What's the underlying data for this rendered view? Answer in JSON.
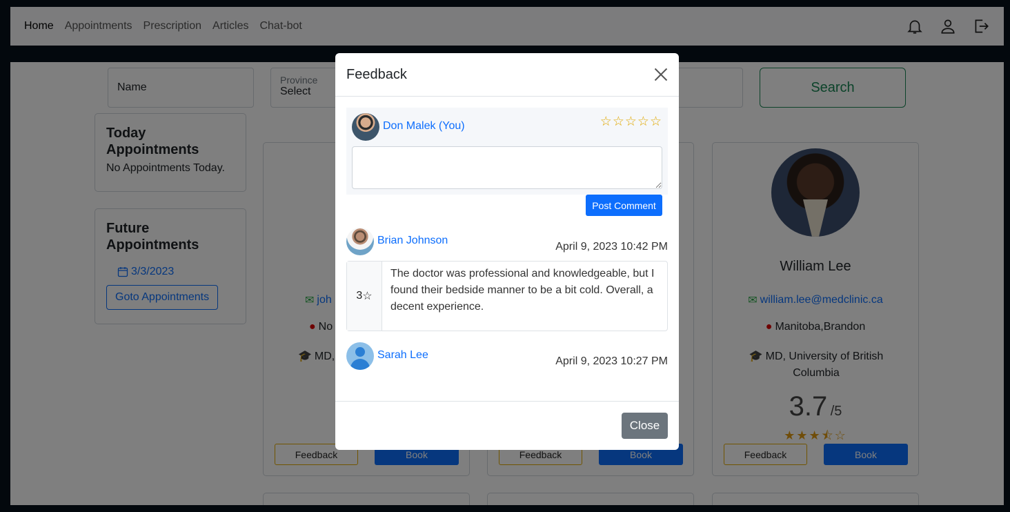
{
  "nav": {
    "items": [
      "Home",
      "Appointments",
      "Prescription",
      "Articles",
      "Chat-bot"
    ],
    "active": "Home"
  },
  "filters": {
    "name_label": "Name",
    "province_label": "Province",
    "province_value": "Select",
    "search_label": "Search"
  },
  "sidebar": {
    "today_title": "Today Appointments",
    "today_text": "No Appointments Today.",
    "future_title": "Future Appointments",
    "future_date": "3/3/2023",
    "goto_label": "Goto Appointments"
  },
  "doctor_card": {
    "name": "William Lee",
    "email": "william.lee@medclinic.ca",
    "location": "Manitoba,Brandon",
    "degree": "MD, University of British Columbia",
    "rating": "3.7",
    "rating_out_of": "/5",
    "stars": 3.5,
    "feedback_label": "Feedback",
    "book_label": "Book"
  },
  "partial_cards": {
    "email_partial": "joh",
    "location_partial": "No",
    "degree_partial": "MD,"
  },
  "modal": {
    "title": "Feedback",
    "current_user": "Don Malek (You)",
    "comment_value": "",
    "post_label": "Post Comment",
    "close_label": "Close",
    "reviews": [
      {
        "user": "Brian Johnson",
        "date": "April 9, 2023 10:42 PM",
        "score": "3",
        "text": "The doctor was professional and knowledgeable, but I found their bedside manner to be a bit cold. Overall, a decent experience."
      },
      {
        "user": "Sarah Lee",
        "date": "April 9, 2023 10:27 PM"
      }
    ]
  },
  "colors": {
    "primary": "#0d6efd",
    "success": "#198754",
    "warning": "#e0a800",
    "secondary": "#6c757d"
  }
}
